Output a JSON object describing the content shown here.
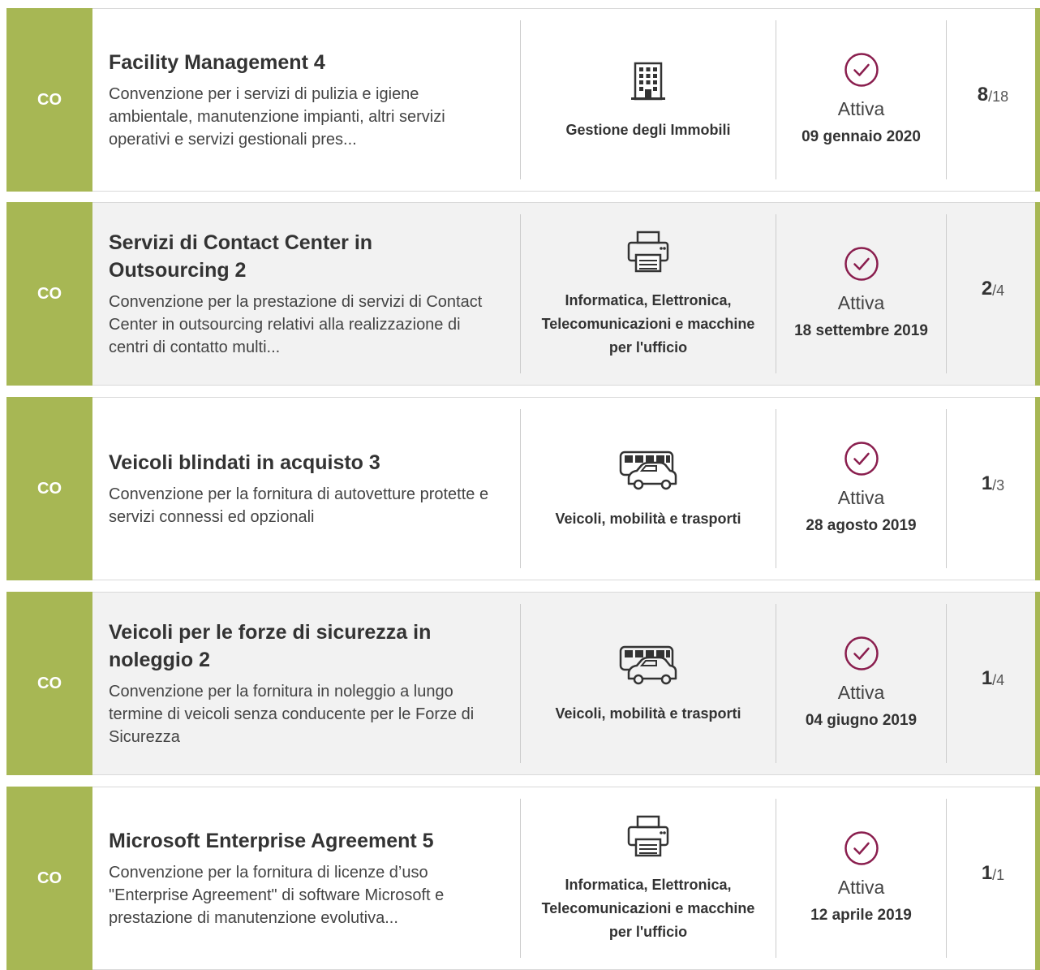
{
  "colors": {
    "tag_green": "#a7b754",
    "check_purple": "#8a1e4e",
    "row_grey": "#f2f2f2"
  },
  "items": [
    {
      "tag": "CO",
      "title": "Facility Management 4",
      "description": "Convenzione per i servizi di pulizia e igiene ambientale, manutenzione impianti, altri servizi operativi e servizi gestionali pres...",
      "category_icon": "building-icon",
      "category": "Gestione degli Immobili",
      "status": "Attiva",
      "date": "09 gennaio 2020",
      "count_active": "8",
      "count_total": "/18"
    },
    {
      "tag": "CO",
      "title": "Servizi di Contact Center in Outsourcing 2",
      "description": "Convenzione per la prestazione di servizi di Contact Center in outsourcing relativi alla realizzazione di centri di contatto multi...",
      "category_icon": "printer-icon",
      "category": "Informatica, Elettronica, Telecomunicazioni e macchine per l'ufficio",
      "status": "Attiva",
      "date": "18 settembre 2019",
      "count_active": "2",
      "count_total": "/4"
    },
    {
      "tag": "CO",
      "title": "Veicoli blindati in acquisto 3",
      "description": "Convenzione per la fornitura di autovetture protette e servizi connessi ed opzionali",
      "category_icon": "vehicles-icon",
      "category": "Veicoli, mobilità e trasporti",
      "status": "Attiva",
      "date": "28 agosto 2019",
      "count_active": "1",
      "count_total": "/3"
    },
    {
      "tag": "CO",
      "title": "Veicoli per le forze di sicurezza in noleggio 2",
      "description": "Convenzione per la fornitura in noleggio a lungo termine di veicoli senza conducente per le Forze di Sicurezza",
      "category_icon": "vehicles-icon",
      "category": "Veicoli, mobilità e trasporti",
      "status": "Attiva",
      "date": "04 giugno 2019",
      "count_active": "1",
      "count_total": "/4"
    },
    {
      "tag": "CO",
      "title": "Microsoft Enterprise Agreement 5",
      "description": "Convenzione per la fornitura di licenze d’uso \"Enterprise Agreement\" di software Microsoft e prestazione di manutenzione evolutiva...",
      "category_icon": "printer-icon",
      "category": "Informatica, Elettronica, Telecomunicazioni e macchine per l'ufficio",
      "status": "Attiva",
      "date": "12 aprile 2019",
      "count_active": "1",
      "count_total": "/1"
    }
  ]
}
